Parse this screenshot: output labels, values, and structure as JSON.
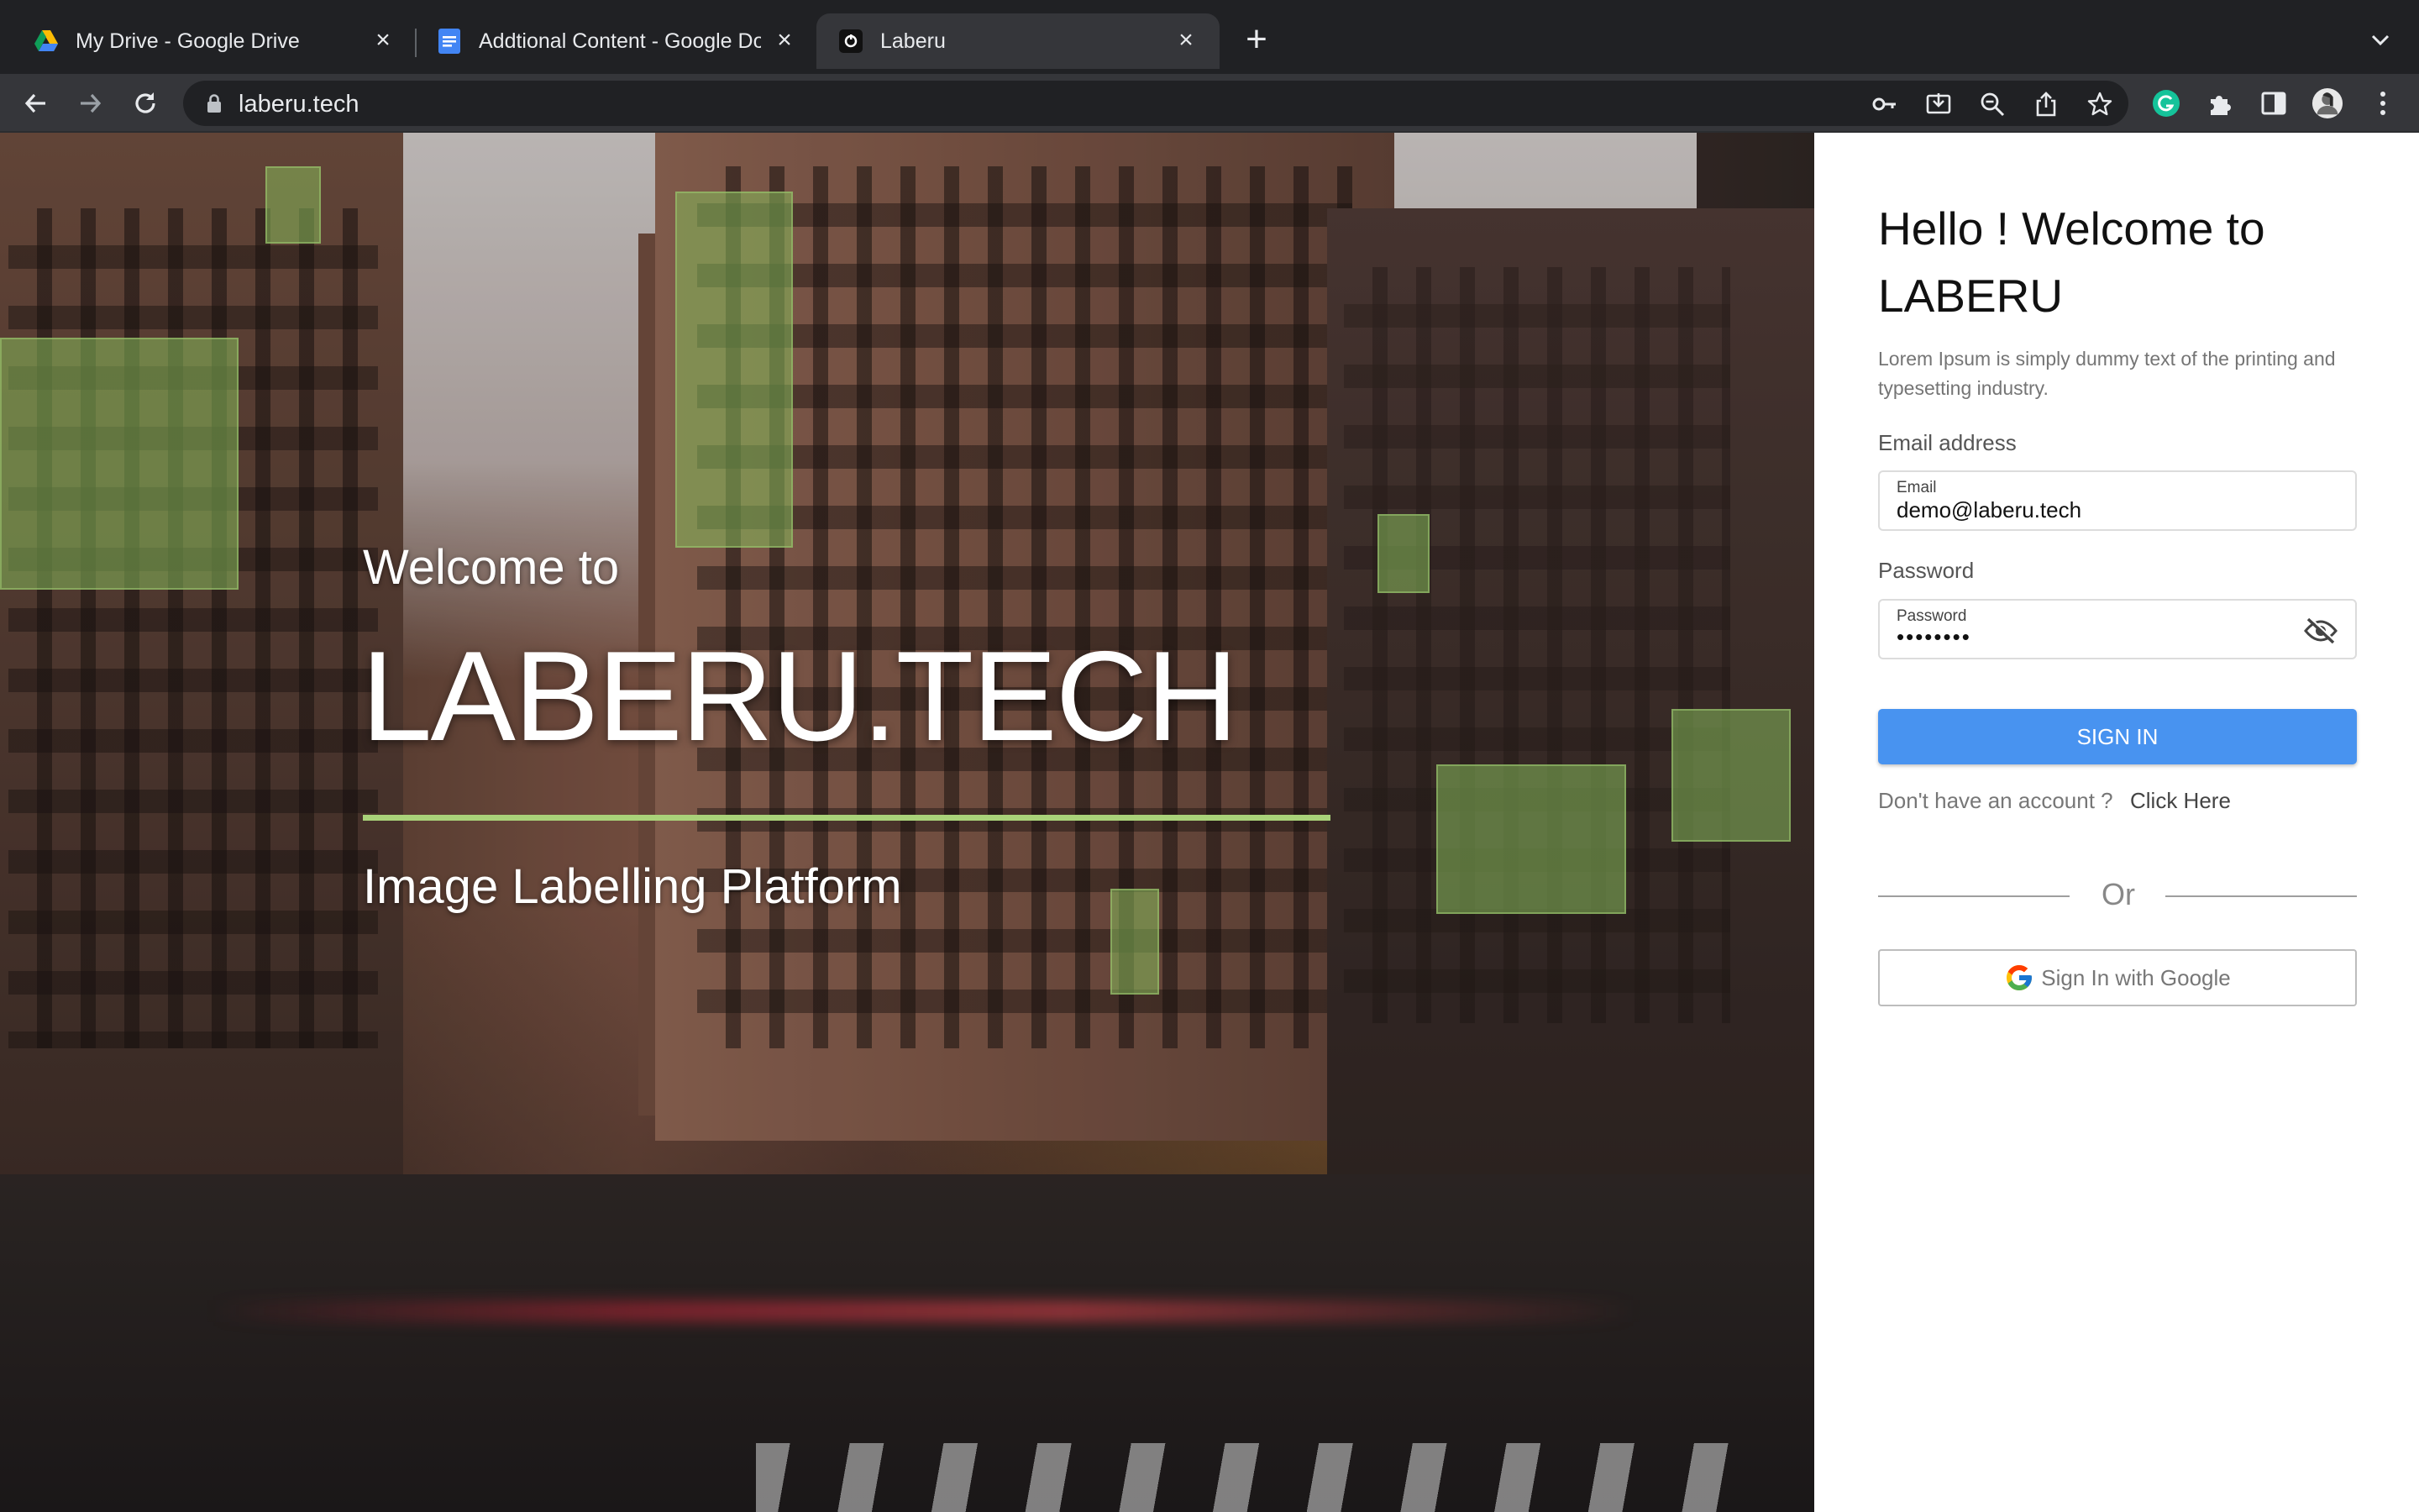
{
  "browser": {
    "tabs": [
      {
        "title": "My Drive - Google Drive",
        "icon": "google-drive-icon",
        "active": false
      },
      {
        "title": "Addtional Content - Google Do",
        "icon": "google-docs-icon",
        "active": false
      },
      {
        "title": "Laberu",
        "icon": "laberu-favicon",
        "active": true
      }
    ],
    "url": "laberu.tech"
  },
  "hero": {
    "welcome": "Welcome to",
    "title": "LABERU.TECH",
    "subtitle": "Image Labelling Platform",
    "accent_color": "#a9d279"
  },
  "signin": {
    "heading": "Hello ! Welcome to LABERU",
    "description": "Lorem Ipsum is simply dummy text of the printing and typesetting industry.",
    "email_label": "Email address",
    "email_field_label": "Email",
    "email_value": "demo@laberu.tech",
    "password_label": "Password",
    "password_field_label": "Password",
    "password_value": "••••••••",
    "signin_button": "SIGN IN",
    "signin_color": "#4893f0",
    "no_account_text": "Don't have an account ?",
    "click_here": "Click Here",
    "or_text": "Or",
    "google_button": "Sign In with Google"
  }
}
